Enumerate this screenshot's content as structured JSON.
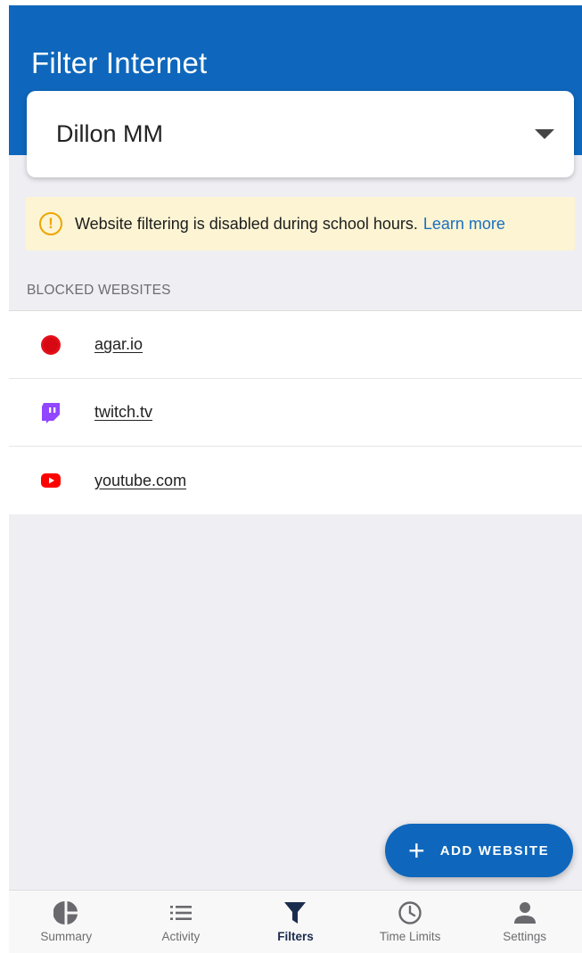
{
  "header": {
    "title": "Filter Internet"
  },
  "child_selector": {
    "selected": "Dillon MM"
  },
  "notice": {
    "text": "Website filtering is disabled during school hours.",
    "link": "Learn more"
  },
  "blocked_section": {
    "label": "BLOCKED WEBSITES",
    "sites": [
      {
        "name": "agar.io",
        "icon": "agar-icon"
      },
      {
        "name": "twitch.tv",
        "icon": "twitch-icon"
      },
      {
        "name": "youtube.com",
        "icon": "youtube-icon"
      }
    ]
  },
  "fab": {
    "label": "ADD WEBSITE"
  },
  "nav": {
    "items": [
      {
        "label": "Summary",
        "icon": "pie-chart-icon"
      },
      {
        "label": "Activity",
        "icon": "list-icon"
      },
      {
        "label": "Filters",
        "icon": "filter-icon",
        "active": true
      },
      {
        "label": "Time Limits",
        "icon": "clock-icon"
      },
      {
        "label": "Settings",
        "icon": "person-icon"
      }
    ]
  },
  "colors": {
    "brand": "#0e67bc",
    "notice_bg": "#fcf4d3",
    "warning": "#f0a500",
    "nav_active": "#1b2d4f"
  }
}
